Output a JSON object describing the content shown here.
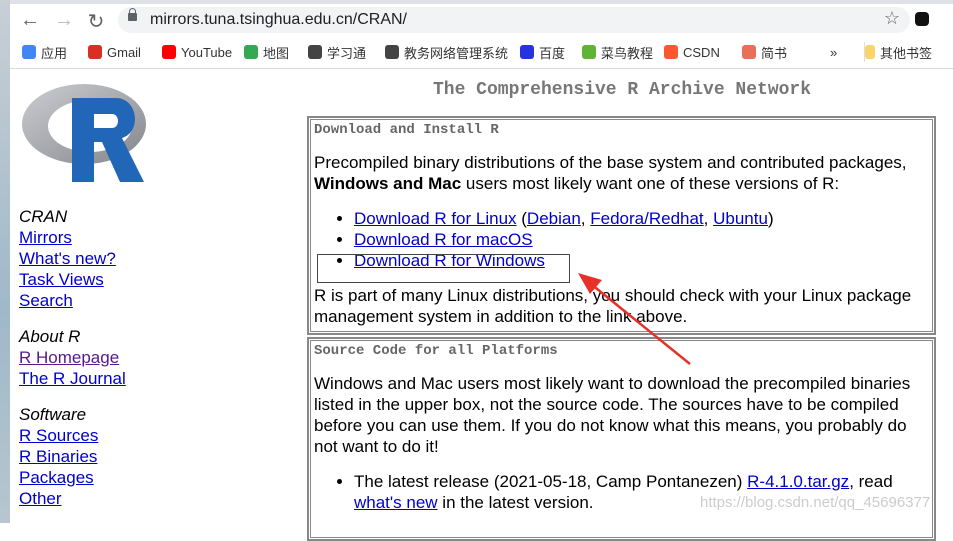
{
  "browser": {
    "url": "mirrors.tuna.tsinghua.edu.cn/CRAN/",
    "bookmarks": [
      {
        "label": "应用",
        "icon": "apps-grid-icon",
        "color": "#4285f4"
      },
      {
        "label": "Gmail",
        "icon": "gmail-icon",
        "color": "#d93025"
      },
      {
        "label": "YouTube",
        "icon": "youtube-icon",
        "color": "#ff0000"
      },
      {
        "label": "地图",
        "icon": "maps-icon",
        "color": "#34a853"
      },
      {
        "label": "学习通",
        "icon": "globe-icon",
        "color": "#444"
      },
      {
        "label": "教务网络管理系统",
        "icon": "globe-icon",
        "color": "#444"
      },
      {
        "label": "百度",
        "icon": "baidu-paw-icon",
        "color": "#2932e1"
      },
      {
        "label": "菜鸟教程",
        "icon": "runoob-icon",
        "color": "#5fb336"
      },
      {
        "label": "CSDN",
        "icon": "csdn-icon",
        "color": "#fc5531"
      },
      {
        "label": "简书",
        "icon": "jianshu-icon",
        "color": "#ea6f5a"
      }
    ],
    "more": "»",
    "other_bookmarks": "其他书签"
  },
  "sidebar": {
    "sections": [
      {
        "heading": "CRAN",
        "links": [
          "Mirrors",
          "What's new?",
          "Task Views",
          "Search"
        ]
      },
      {
        "heading": "About R",
        "links": [
          "R Homepage",
          "The R Journal"
        ]
      },
      {
        "heading": "Software",
        "links": [
          "R Sources",
          "R Binaries",
          "Packages",
          "Other"
        ]
      }
    ]
  },
  "main": {
    "title": "The Comprehensive R Archive Network",
    "box1": {
      "heading": "Download and Install R",
      "intro1": "Precompiled binary distributions of the base system and contributed packages, ",
      "intro_bold": "Windows and Mac",
      "intro2": " users most likely want one of these versions of R:",
      "linux": "Download R for Linux",
      "debian": "Debian",
      "fedora": "Fedora/Redhat",
      "ubuntu": "Ubuntu",
      "macos": "Download R for macOS",
      "windows": "Download R for Windows",
      "outro": "R is part of many Linux distributions, you should check with your Linux package management system in addition to the link above."
    },
    "box2": {
      "heading": "Source Code for all Platforms",
      "text": "Windows and Mac users most likely want to download the precompiled binaries listed in the upper box, not the source code. The sources have to be compiled before you can use them. If you do not know what this means, you probably do not want to do it!",
      "release1": "The latest release (2021-05-18, Camp Pontanezen) ",
      "tarball": "R-4.1.0.tar.gz",
      "release2": ", read ",
      "whatsnew": "what's new",
      "release3": " in the latest version."
    }
  },
  "watermark": "https://blog.csdn.net/qq_45696377"
}
